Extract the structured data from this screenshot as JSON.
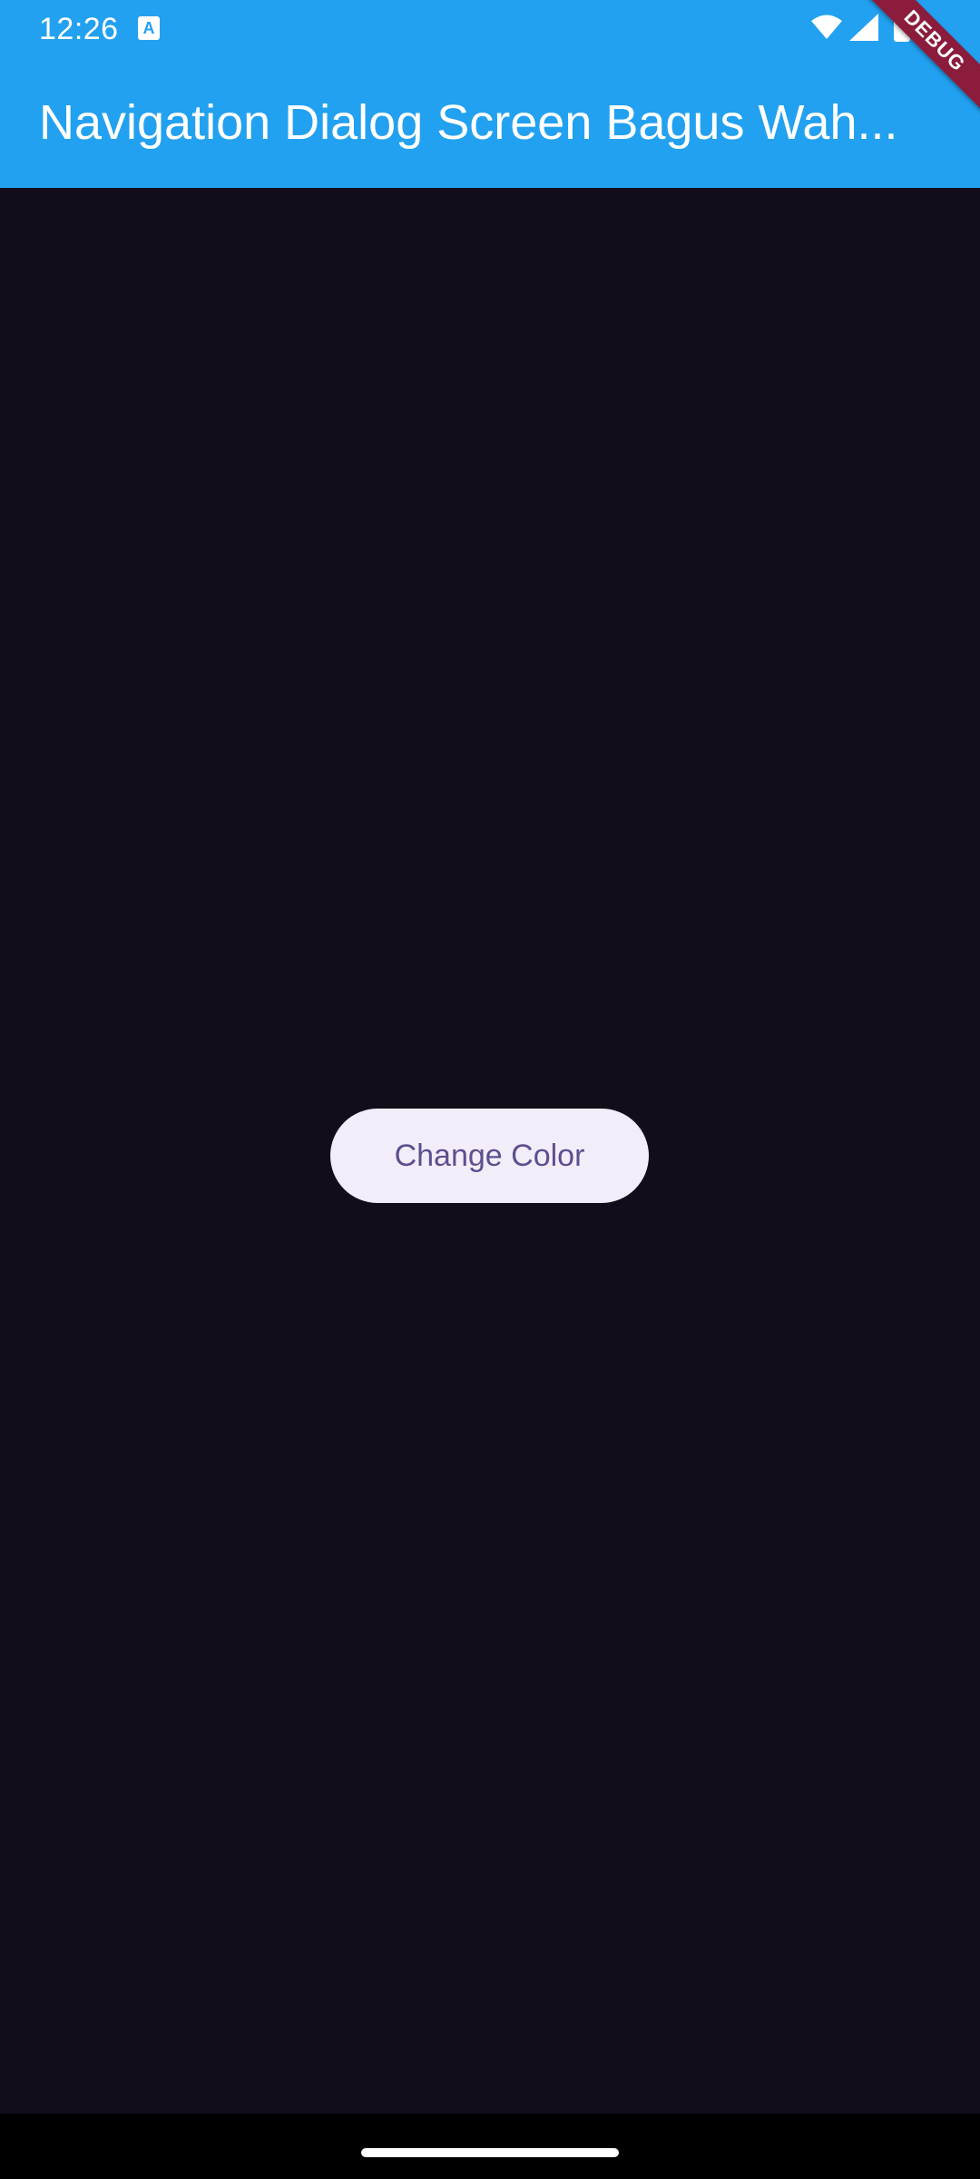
{
  "status_bar": {
    "time": "12:26",
    "notification_icon_glyph": "A",
    "icons": [
      "wifi-icon",
      "signal-icon",
      "battery-icon"
    ]
  },
  "app_bar": {
    "title": "Navigation Dialog Screen Bagus Wah...",
    "background_color": "#22a1f0"
  },
  "debug_banner": {
    "label": "DEBUG"
  },
  "main": {
    "button_label": "Change Color",
    "background_color": "#120d19"
  },
  "colors": {
    "button_background": "#f3edf9",
    "button_text": "#5e4f8f",
    "debug_banner": "#8b1c3c"
  }
}
